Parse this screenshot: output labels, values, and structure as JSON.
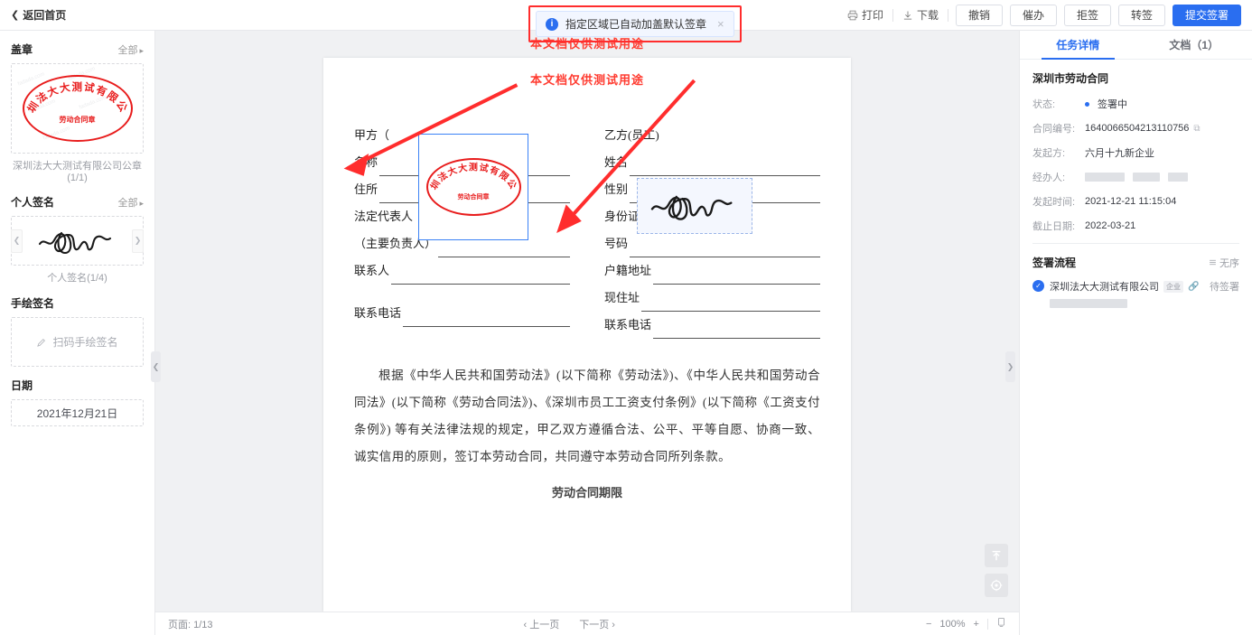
{
  "topbar": {
    "back_label": "返回首页",
    "print_label": "打印",
    "download_label": "下载",
    "buttons": [
      {
        "label": "撤销",
        "primary": false
      },
      {
        "label": "催办",
        "primary": false
      },
      {
        "label": "拒签",
        "primary": false
      },
      {
        "label": "转签",
        "primary": false
      },
      {
        "label": "提交签署",
        "primary": true
      }
    ]
  },
  "notification": {
    "text": "指定区域已自动加盖默认签章",
    "icon": "info-icon",
    "close": "×",
    "highlight_color": "#ff2d2d",
    "accent_color": "#2a6ef0"
  },
  "left_panel": {
    "seal": {
      "title": "盖章",
      "all_label": "全部",
      "seal_company": "深圳法大大测试有限公司",
      "seal_center": "劳动合同章",
      "caption": "深圳法大大测试有限公司公章(1/1)"
    },
    "personal_signature": {
      "title": "个人签名",
      "all_label": "全部",
      "caption": "个人签名(1/4)",
      "prev_icon": "chevron-left-icon",
      "next_icon": "chevron-right-icon"
    },
    "handwritten": {
      "title": "手绘签名",
      "placeholder": "扫码手绘签名",
      "icon": "pencil-icon"
    },
    "date": {
      "title": "日期",
      "value": "2021年12月21日"
    },
    "watermark_text": "fadada.com"
  },
  "document": {
    "watermark": "本文档仅供测试用途",
    "party_a": {
      "heading": "甲方（",
      "rows": [
        {
          "label": "名称",
          "line": true
        },
        {
          "label": "住所",
          "line": true
        },
        {
          "label": "法定代表人",
          "line": false
        },
        {
          "label": "（主要负责人）",
          "line": true
        },
        {
          "label": "联系人",
          "line": true
        },
        {
          "label": "",
          "line": false
        },
        {
          "label": "联系电话",
          "line": true
        }
      ]
    },
    "party_b": {
      "heading": "乙方(员工)",
      "rows": [
        {
          "label": "姓名",
          "line": true
        },
        {
          "label": "性别",
          "line": true
        },
        {
          "label": "身份证（护照）",
          "line": false
        },
        {
          "label": "号码",
          "line": true
        },
        {
          "label": "户籍地址",
          "line": true
        },
        {
          "label": "现住址",
          "line": true
        },
        {
          "label": "联系电话",
          "line": true
        }
      ]
    },
    "paragraph": "根据《中华人民共和国劳动法》(以下简称《劳动法》)、《中华人民共和国劳动合同法》(以下简称《劳动合同法》)、《深圳市员工工资支付条例》(以下简称《工资支付条例》) 等有关法律法规的规定，甲乙双方遵循合法、公平、平等自愿、协商一致、诚实信用的原则，签订本劳动合同，共同遵守本劳动合同所列条款。",
    "next_heading": "劳动合同期限",
    "footer": {
      "page_label": "页面: 1/13",
      "prev_page": "‹ 上一页",
      "next_page": "下一页 ›",
      "zoom_out": "−",
      "zoom_level": "100%",
      "zoom_in": "+",
      "fit_icon": "fit-page-icon"
    },
    "float_buttons": [
      {
        "name": "scroll-to-top-button",
        "icon": "arrow-up-to-line-icon"
      },
      {
        "name": "locate-signature-button",
        "icon": "target-icon"
      }
    ]
  },
  "right_panel": {
    "tabs": [
      {
        "label": "任务详情",
        "active": true
      },
      {
        "label": "文档（1）",
        "active": false
      }
    ],
    "doc_title": "深圳市劳动合同",
    "fields": [
      {
        "key": "状态:",
        "value": "签署中",
        "type": "status"
      },
      {
        "key": "合同编号:",
        "value": "1640066504213110756",
        "type": "copy"
      },
      {
        "key": "发起方:",
        "value": "六月十九新企业",
        "type": "text"
      },
      {
        "key": "经办人:",
        "value": "",
        "type": "redacted"
      },
      {
        "key": "发起时间:",
        "value": "2021-12-21 11:15:04",
        "type": "text"
      },
      {
        "key": "截止日期:",
        "value": "2022-03-21",
        "type": "text"
      }
    ],
    "flow": {
      "title": "签署流程",
      "order_label": "无序",
      "order_icon": "unordered-icon",
      "items": [
        {
          "name": "深圳法大大测试有限公司",
          "badge": "企业",
          "link_icon": "link-icon",
          "status": "待签署"
        }
      ]
    }
  }
}
